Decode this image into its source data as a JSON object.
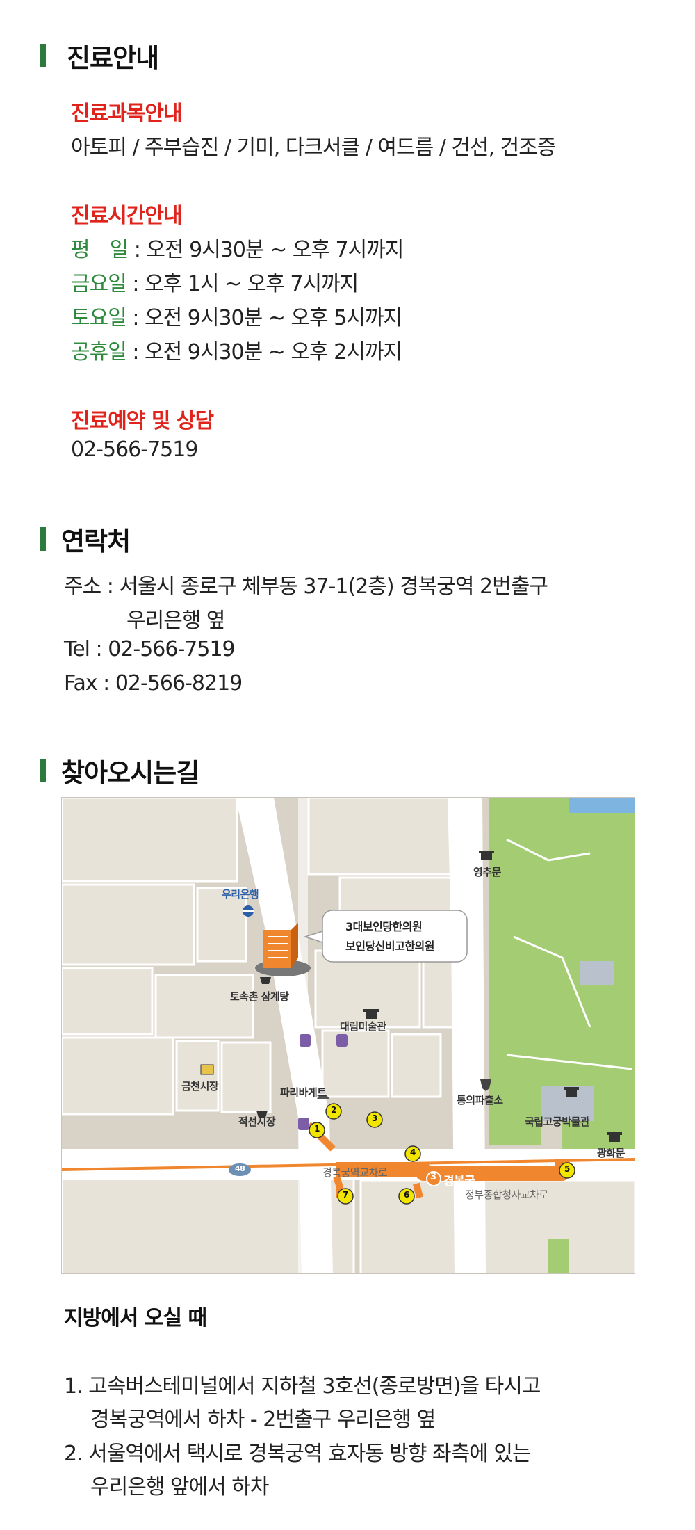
{
  "section1": {
    "heading": "진료안내",
    "subjects": {
      "title": "진료과목안내",
      "text": "아토피 / 주부습진 / 기미, 다크서클 / 여드름 / 건선, 건조증"
    },
    "hours": {
      "title": "진료시간안내",
      "rows": [
        {
          "day": "평　일",
          "time": " : 오전 9시30분 ~ 오후 7시까지"
        },
        {
          "day": "금요일",
          "time": " : 오후 1시 ~ 오후 7시까지"
        },
        {
          "day": "토요일",
          "time": " : 오전 9시30분 ~ 오후 5시까지"
        },
        {
          "day": "공휴일",
          "time": " : 오전 9시30분 ~ 오후 2시까지"
        }
      ]
    },
    "reservation": {
      "title": "진료예약 및 상담",
      "phone": "02-566-7519"
    }
  },
  "section2": {
    "heading": "연락처",
    "address_line1": "주소 : 서울시 종로구 체부동 37-1(2층) 경복궁역 2번출구",
    "address_line2": "우리은행 옆",
    "tel": "Tel : 02-566-7519",
    "fax": "Fax : 02-566-8219"
  },
  "section3": {
    "heading": "찾아오시는길",
    "map": {
      "callout_line1": "3대보인당한의원",
      "callout_line2": "보인당신비고한의원",
      "labels": {
        "woori_bank": "우리은행",
        "tosokchon": "토속촌 삼계탕",
        "daelim": "대림미술관",
        "geumcheon": "금천시장",
        "paris": "파리바게트",
        "jeokseon": "적선시장",
        "tongui": "통의파출소",
        "museum": "국립고궁박물관",
        "yeongchu": "영추문",
        "gwanghwa": "광화문",
        "intersection1": "경복궁역교차로",
        "intersection2": "정부종합청사교차로",
        "station": "경복궁",
        "line_number": "3",
        "road_number": "48"
      },
      "exits": [
        "1",
        "2",
        "3",
        "4",
        "5",
        "6",
        "7"
      ],
      "colors": {
        "line3": "#f0862d",
        "park": "#a3cc73",
        "road": "#ffffff",
        "block": "#e8e3d8",
        "base": "#d9d3c7"
      }
    },
    "from_local": {
      "title": "지방에서 오실 때",
      "items": [
        {
          "line1": "1. 고속버스테미널에서 지하철 3호선(종로방면)을 타시고",
          "line2": "경복궁역에서 하차 - 2번출구 우리은행 옆"
        },
        {
          "line1": "2. 서울역에서 택시로 경복궁역 효자동 방향 좌측에 있는",
          "line2": "우리은행 앞에서 하차"
        }
      ]
    }
  }
}
